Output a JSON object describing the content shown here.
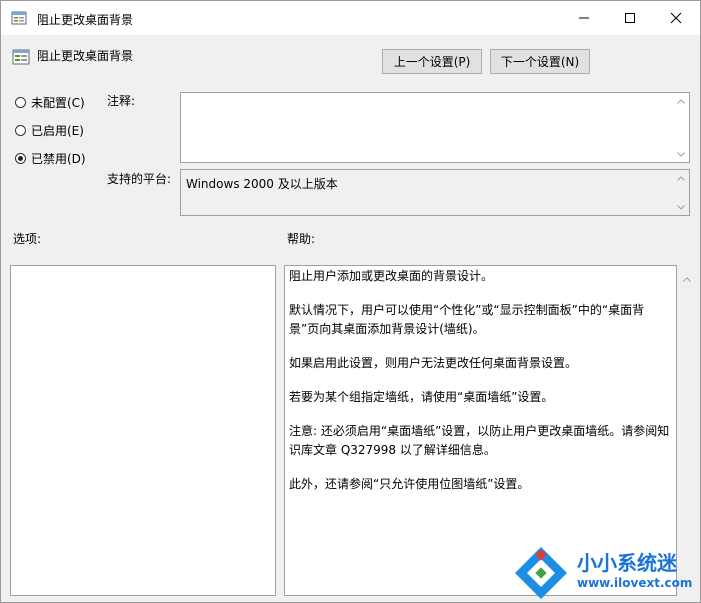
{
  "window": {
    "title": "阻止更改桌面背景"
  },
  "header": {
    "title": "阻止更改桌面背景",
    "prev_label": "上一个设置(P)",
    "next_label": "下一个设置(N)"
  },
  "state": {
    "not_configured": "未配置(C)",
    "enabled": "已启用(E)",
    "disabled": "已禁用(D)",
    "selected": "disabled"
  },
  "comment": {
    "label": "注释:",
    "value": ""
  },
  "platform": {
    "label": "支持的平台:",
    "value": "Windows 2000 及以上版本"
  },
  "options": {
    "label": "选项:"
  },
  "help": {
    "label": "帮助:",
    "paragraphs": [
      "阻止用户添加或更改桌面的背景设计。",
      "默认情况下，用户可以使用“个性化”或“显示控制面板”中的“桌面背景”页向其桌面添加背景设计(墙纸)。",
      "如果启用此设置，则用户无法更改任何桌面背景设置。",
      "若要为某个组指定墙纸，请使用“桌面墙纸”设置。",
      "注意: 还必须启用“桌面墙纸”设置，以防止用户更改桌面墙纸。请参阅知识库文章 Q327998 以了解详细信息。",
      "此外，还请参阅“只允许使用位图墙纸”设置。"
    ]
  },
  "watermark": {
    "title": "小小系统迷",
    "url": "www.ilovext.com"
  },
  "icons": {
    "policy": "policy-setting-icon",
    "minimize": "minimize-icon",
    "maximize": "maximize-icon",
    "close": "close-icon",
    "brand": "brand-logo-icon"
  },
  "colors": {
    "watermark": "#1a73d9",
    "button_face": "#e1e1e1"
  }
}
